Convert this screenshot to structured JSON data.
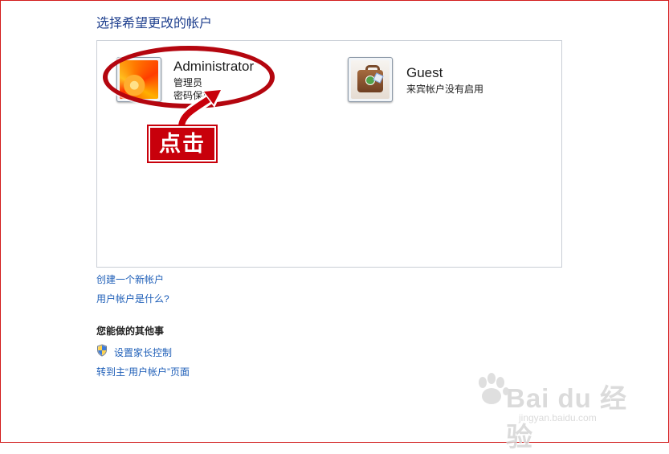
{
  "page": {
    "title": "选择希望更改的帐户"
  },
  "accounts": [
    {
      "name": "Administrator",
      "role": "管理员",
      "status": "密码保护",
      "picture": "flower-avatar-icon"
    },
    {
      "name": "Guest",
      "status": "来宾帐户没有启用",
      "picture": "suitcase-avatar-icon"
    }
  ],
  "annotation": {
    "callout_text": "点击",
    "accent_color": "#c8000b"
  },
  "links": {
    "create_account": "创建一个新帐户",
    "what_is_account": "用户帐户是什么?"
  },
  "other_tasks": {
    "heading": "您能做的其他事",
    "items": [
      {
        "label": "设置家长控制",
        "icon": "uac-shield-icon"
      },
      {
        "label": "转到主“用户帐户”页面"
      }
    ]
  },
  "watermark": {
    "main": "Bai du 经验",
    "sub": "jingyan.baidu.com"
  },
  "colors": {
    "title": "#1e3f8e",
    "link": "#1f5fb8",
    "border": "#d21c1c"
  }
}
